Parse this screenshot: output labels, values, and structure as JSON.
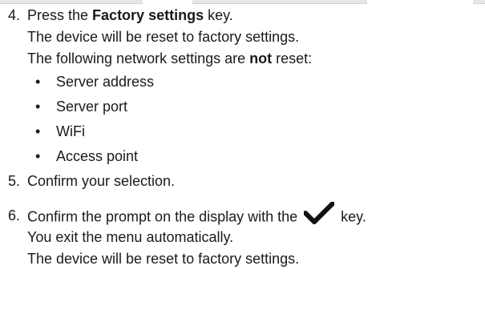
{
  "steps": [
    {
      "number": "4.",
      "main_pre": "Press the ",
      "main_bold": "Factory settings",
      "main_post": " key.",
      "line2": "The device will be reset to factory settings.",
      "line3_pre": "The following network settings are ",
      "line3_bold": "not",
      "line3_post": " reset:",
      "bullets": [
        "Server address",
        "Server port",
        "WiFi",
        "Access point"
      ]
    },
    {
      "number": "5.",
      "main": "Confirm your selection."
    },
    {
      "number": "6.",
      "main_pre": "Confirm the prompt on the display with the",
      "icon": "checkmark-icon",
      "main_post": "key.",
      "line2": "You exit the menu automatically.",
      "line3": "The device will be reset to factory settings."
    }
  ]
}
